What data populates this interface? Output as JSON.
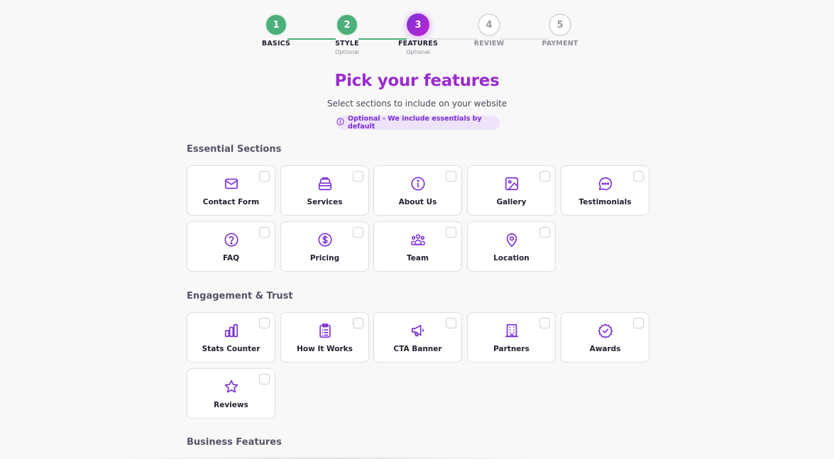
{
  "stepper": {
    "steps": [
      {
        "number": "1",
        "label": "BASICS",
        "sub": ""
      },
      {
        "number": "2",
        "label": "STYLE",
        "sub": "Optional"
      },
      {
        "number": "3",
        "label": "FEATURES",
        "sub": "Optional"
      },
      {
        "number": "4",
        "label": "REVIEW",
        "sub": ""
      },
      {
        "number": "5",
        "label": "PAYMENT",
        "sub": ""
      }
    ],
    "current_step": 3
  },
  "header": {
    "title": "Pick your features",
    "subtitle": "Select sections to include on your website",
    "optional_note": "Optional - We include essentials by default"
  },
  "colors": {
    "accent": "#7b2fd6",
    "title": "#9a2bd0",
    "complete": "#4caf7a"
  },
  "sections": {
    "essential": {
      "title": "Essential Sections",
      "items": [
        {
          "label": "Contact Form",
          "icon": "envelope-icon",
          "checked": false
        },
        {
          "label": "Services",
          "icon": "briefcase-icon",
          "checked": false
        },
        {
          "label": "About Us",
          "icon": "info-icon",
          "checked": false
        },
        {
          "label": "Gallery",
          "icon": "image-icon",
          "checked": false
        },
        {
          "label": "Testimonials",
          "icon": "chat-bubble-icon",
          "checked": false
        },
        {
          "label": "FAQ",
          "icon": "question-icon",
          "checked": false
        },
        {
          "label": "Pricing",
          "icon": "dollar-icon",
          "checked": false
        },
        {
          "label": "Team",
          "icon": "team-icon",
          "checked": false
        },
        {
          "label": "Location",
          "icon": "map-pin-icon",
          "checked": false
        }
      ]
    },
    "engagement": {
      "title": "Engagement & Trust",
      "items": [
        {
          "label": "Stats Counter",
          "icon": "bar-chart-icon",
          "checked": false
        },
        {
          "label": "How It Works",
          "icon": "clipboard-icon",
          "checked": false
        },
        {
          "label": "CTA Banner",
          "icon": "megaphone-icon",
          "checked": false
        },
        {
          "label": "Partners",
          "icon": "building-icon",
          "checked": false
        },
        {
          "label": "Awards",
          "icon": "badge-check-icon",
          "checked": false
        },
        {
          "label": "Reviews",
          "icon": "star-icon",
          "checked": false
        }
      ]
    },
    "business": {
      "title": "Business Features"
    }
  }
}
